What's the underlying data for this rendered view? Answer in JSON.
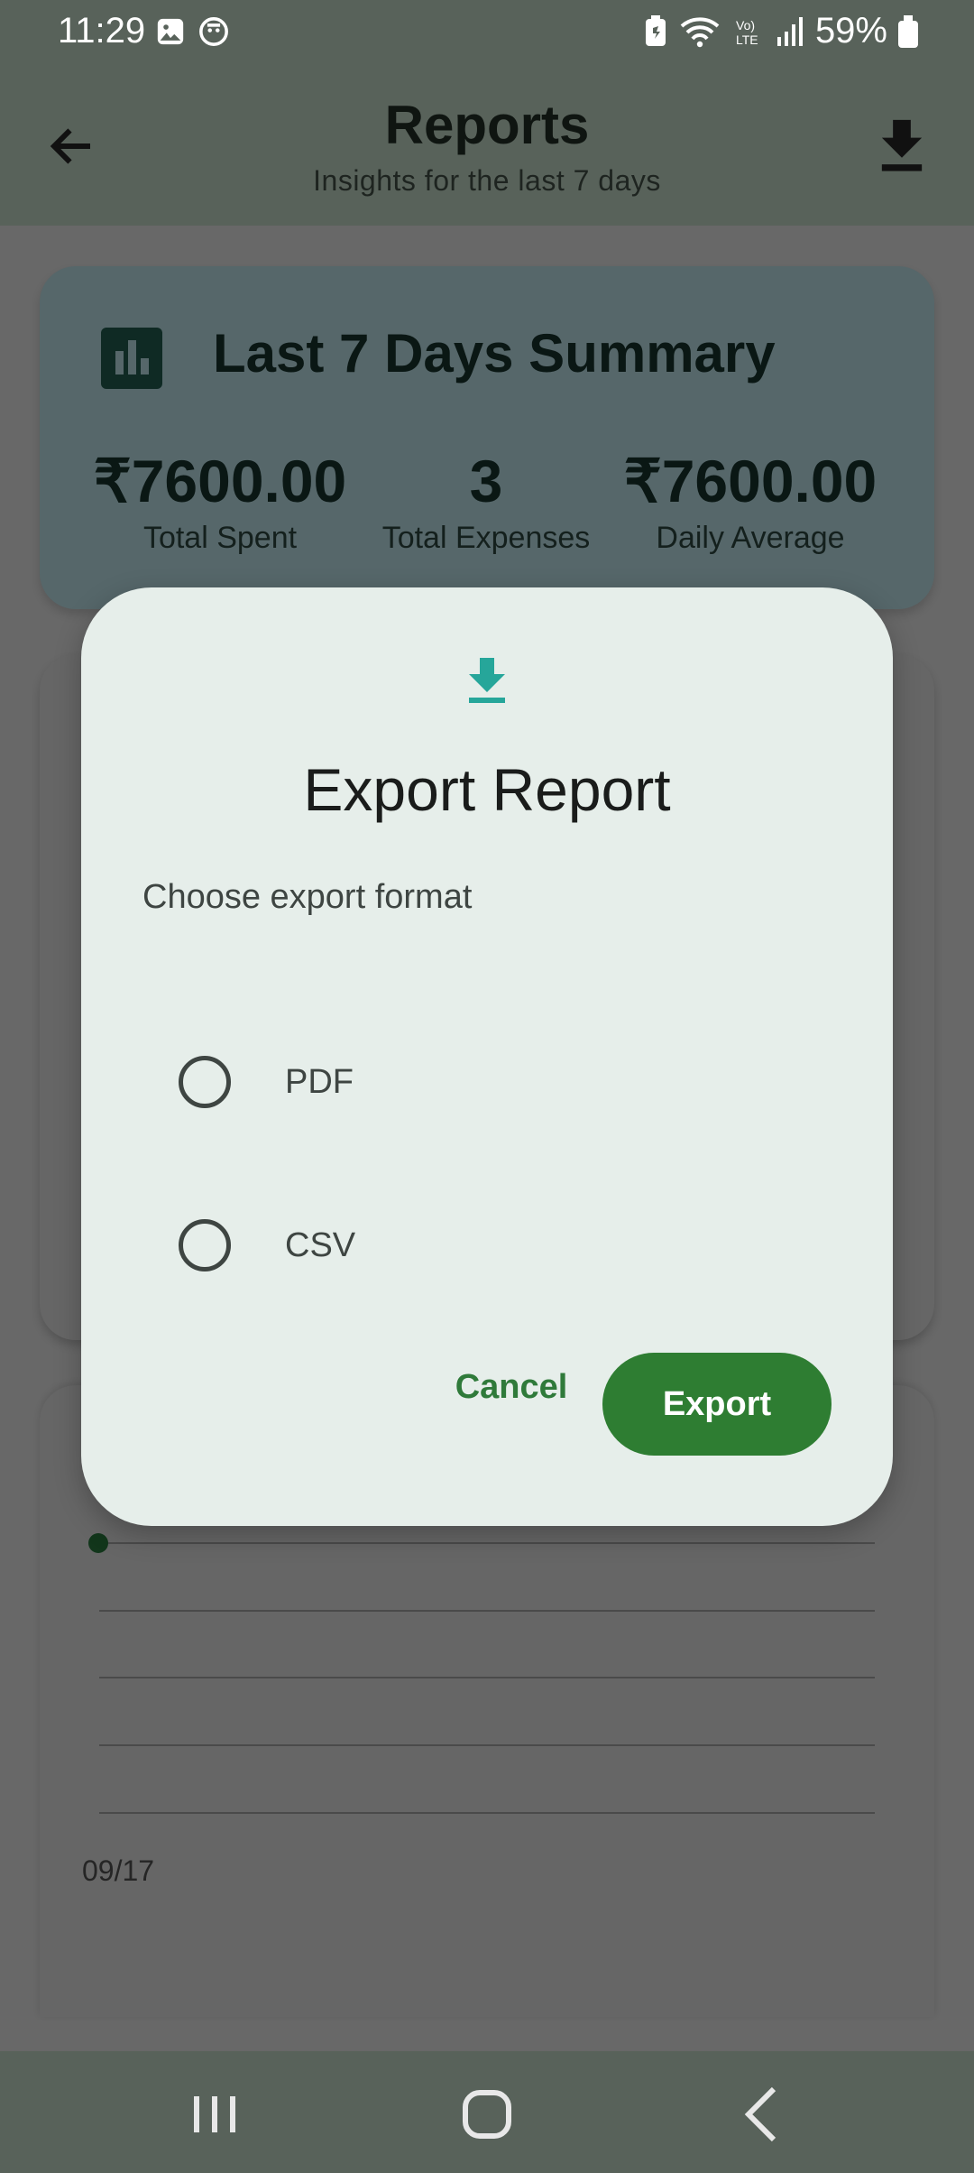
{
  "status_bar": {
    "time": "11:29",
    "battery": "59%",
    "left_icons": [
      "image-icon",
      "face-icon"
    ],
    "right_icons": [
      "battery-saver-icon",
      "wifi-icon",
      "volte-icon",
      "signal-icon",
      "battery-icon"
    ]
  },
  "app_bar": {
    "title": "Reports",
    "subtitle": "Insights for the last 7 days",
    "back_icon": "arrow-left-icon",
    "download_icon": "download-icon"
  },
  "summary": {
    "title": "Last 7 Days Summary",
    "icon": "bar-chart-icon",
    "stats": [
      {
        "value": "₹7600.00",
        "label": "Total Spent"
      },
      {
        "value": "3",
        "label": "Total Expenses"
      },
      {
        "value": "₹7600.00",
        "label": "Daily Average"
      }
    ]
  },
  "chart": {
    "x_label": "09/17"
  },
  "dialog": {
    "icon": "download-icon",
    "title": "Export Report",
    "subtitle": "Choose export format",
    "options": [
      "PDF",
      "CSV"
    ],
    "cancel_label": "Cancel",
    "export_label": "Export"
  },
  "nav_bar": {
    "items": [
      "recents-icon",
      "home-icon",
      "back-icon"
    ]
  },
  "colors": {
    "accent": "#2e7d32",
    "dialog_icon": "#26a69a",
    "dialog_bg": "#e6eeea"
  }
}
